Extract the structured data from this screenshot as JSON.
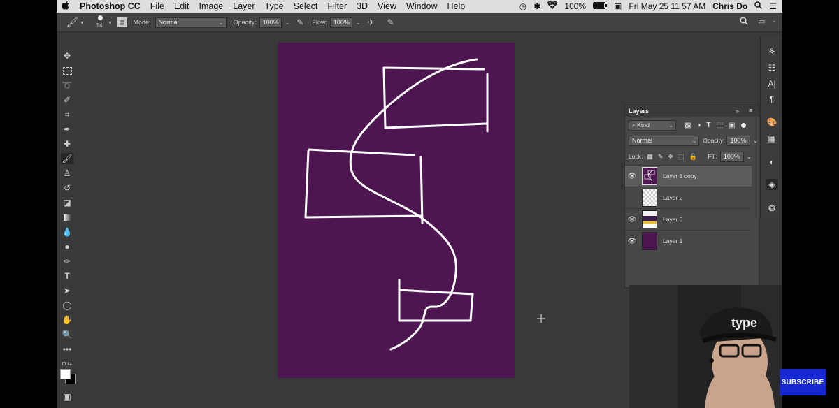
{
  "menubar": {
    "apple_icon": "apple-icon",
    "app_name": "Photoshop CC",
    "items": [
      "File",
      "Edit",
      "Image",
      "Layer",
      "Type",
      "Select",
      "Filter",
      "3D",
      "View",
      "Window",
      "Help"
    ],
    "battery": "100%",
    "datetime": "Fri May 25  11 57 AM",
    "user": "Chris Do"
  },
  "options": {
    "brush_size": "14",
    "mode_label": "Mode:",
    "mode_value": "Normal",
    "opacity_label": "Opacity:",
    "opacity_value": "100%",
    "flow_label": "Flow:",
    "flow_value": "100%"
  },
  "layers_panel": {
    "title": "Layers",
    "filter_value": "Kind",
    "blend_mode": "Normal",
    "opacity_label": "Opacity:",
    "opacity_value": "100%",
    "lock_label": "Lock:",
    "fill_label": "Fill:",
    "fill_value": "100%",
    "layers": [
      {
        "name": "Layer 1 copy",
        "visible": true,
        "selected": true
      },
      {
        "name": "Layer 2",
        "visible": false,
        "selected": false
      },
      {
        "name": "Layer 0",
        "visible": true,
        "selected": false
      },
      {
        "name": "Layer 1",
        "visible": true,
        "selected": false
      }
    ]
  },
  "webcam": {
    "cap_text": "type"
  },
  "subscribe": {
    "label": "SUBSCRIBE"
  },
  "colors": {
    "canvas": "#4d1650",
    "app_bg": "#393939",
    "subscribe_bg": "#1427d0"
  }
}
